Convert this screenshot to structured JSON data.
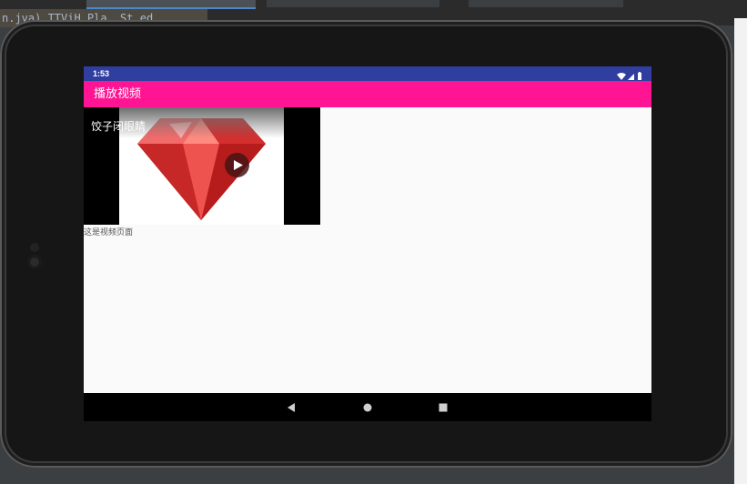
{
  "ide": {
    "code_fragment": "n.jva) TTViH Pla. St ed"
  },
  "status_bar": {
    "time": "1:53",
    "icons": [
      "wifi-icon",
      "signal-icon",
      "battery-icon"
    ]
  },
  "app_bar": {
    "title": "播放视频"
  },
  "video": {
    "title": "饺子闭眼睛",
    "thumbnail": "ruby-gem-icon",
    "play_icon": "play-icon"
  },
  "content": {
    "page_label": "这是视频页面"
  },
  "nav_bar": {
    "buttons": [
      "back-icon",
      "home-icon",
      "recents-icon"
    ]
  },
  "colors": {
    "status_bar": "#303f9f",
    "app_bar": "#ff1493",
    "screen_bg": "#fafafa",
    "gem_red": "#e53935"
  }
}
